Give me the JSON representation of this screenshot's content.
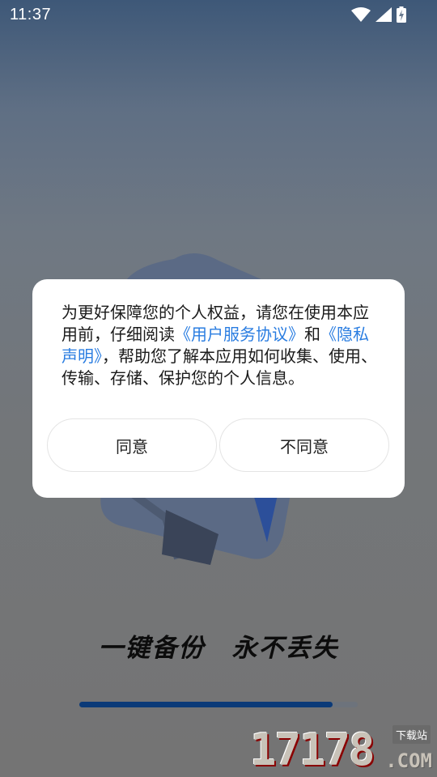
{
  "status_bar": {
    "time": "11:37",
    "icons": [
      "wifi-icon",
      "cellular-signal-icon",
      "battery-charging-icon"
    ]
  },
  "splash": {
    "slogan": "一键备份　永不丢失",
    "progress_fraction": 0.91
  },
  "dialog": {
    "text_intro": "为更好保障您的个人权益，请您在使用本应用前，仔细阅读",
    "link_user_agreement": "《用户服务协议》",
    "text_and": "和",
    "link_privacy": "《隐私声明》",
    "text_outro": "，帮助您了解本应用如何收集、使用、传输、存储、保护您的个人信息。",
    "agree_label": "同意",
    "disagree_label": "不同意"
  },
  "watermark": {
    "number": "17178",
    "tag": "下载站",
    "domain": ".COM"
  },
  "colors": {
    "link": "#2a7de1",
    "progress": "#0b3a78"
  }
}
